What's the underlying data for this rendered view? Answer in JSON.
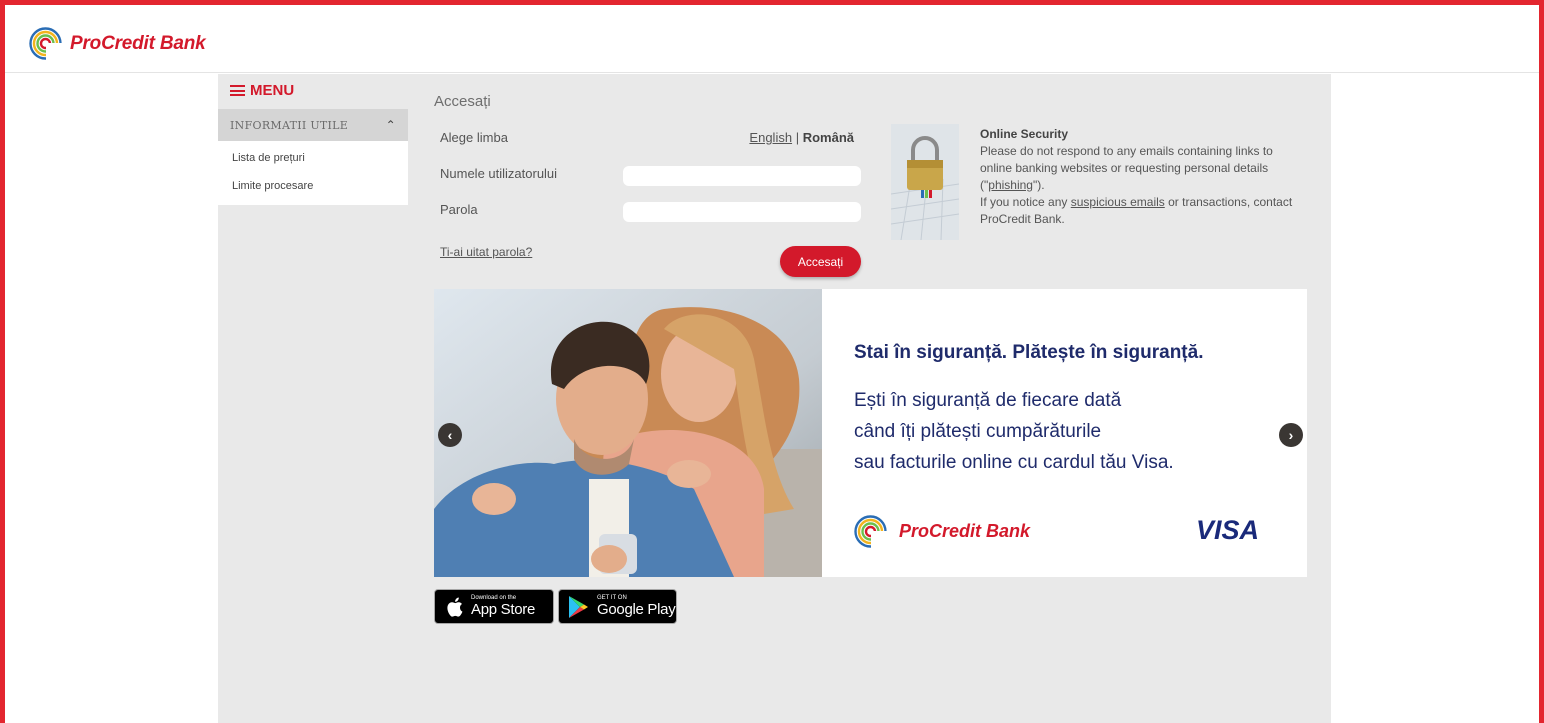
{
  "header": {
    "brand": "ProCredit Bank"
  },
  "sidebar": {
    "menu_label": "MENU",
    "section_title": "INFORMATII UTILE",
    "items": [
      {
        "label": "Lista de prețuri"
      },
      {
        "label": "Limite procesare"
      }
    ]
  },
  "login": {
    "title": "Accesați",
    "language_label": "Alege limba",
    "languages": {
      "english": "English",
      "separator": "|",
      "romana": "Română"
    },
    "username_label": "Numele utilizatorului",
    "username_value": "",
    "password_label": "Parola",
    "password_value": "",
    "forgot_link": "Ti-ai uitat parola?",
    "submit_label": "Accesați"
  },
  "security": {
    "title": "Online Security",
    "line1": "Please do not respond to any emails containing links to online banking websites or requesting personal details (\"",
    "phishing": "phishing",
    "line1_end": "\").",
    "line2_start": "If you notice any ",
    "suspicious": "suspicious emails",
    "line2_end": " or transactions, contact ProCredit Bank."
  },
  "banner": {
    "headline": "Stai în siguranță. Plătește în siguranță.",
    "body_lines": [
      "Ești în siguranță de fiecare dată",
      "când îți plătești cumpărăturile",
      "sau facturile online cu cardul tău Visa."
    ],
    "brand": "ProCredit Bank",
    "visa": "VISA",
    "prev_glyph": "‹",
    "next_glyph": "›"
  },
  "stores": {
    "apple_small": "Download on the",
    "apple_big": "App Store",
    "google_small": "GET IT ON",
    "google_big": "Google Play"
  },
  "colors": {
    "accent": "#d3192b",
    "navy": "#1f2b6b",
    "panel": "#e9e9e9"
  }
}
